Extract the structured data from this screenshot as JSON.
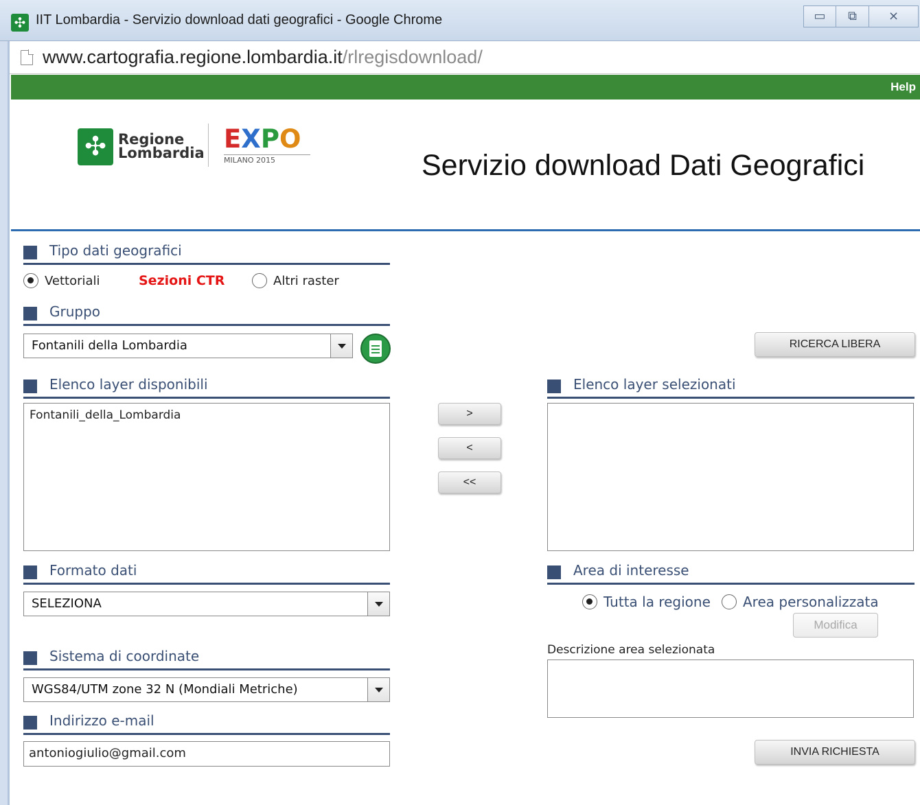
{
  "window": {
    "title": "IIT Lombardia - Servizio download dati geografici - Google Chrome",
    "controls": {
      "minimize": "▭",
      "maximize": "⧉",
      "close": "⨯"
    },
    "app_icon": "regione-lombardia-icon"
  },
  "address_bar": {
    "url_host": "www.cartografia.regione.lombardia.it",
    "url_path": "/rlregisdownload/"
  },
  "topbar": {
    "help_label": "Help",
    "color": "#3a8a38"
  },
  "header": {
    "logo_line1": "Regione",
    "logo_line2": "Lombardia",
    "expo_letters": [
      "E",
      "X",
      "P",
      "O"
    ],
    "expo_subtitle": "MILANO 2015",
    "title": "Servizio download Dati Geografici"
  },
  "tipo": {
    "section_label": "Tipo dati geografici",
    "options": [
      "Vettoriali",
      "Sezioni CTR",
      "Altri raster"
    ],
    "selected": "Vettoriali"
  },
  "gruppo": {
    "section_label": "Gruppo",
    "selected_value": "Fontanili della Lombardia"
  },
  "layer_disponibili": {
    "section_label": "Elenco layer disponibili",
    "items": [
      "Fontanili_della_Lombardia"
    ]
  },
  "transfer_buttons": {
    "add": ">",
    "remove": "<",
    "remove_all": "<<"
  },
  "layer_selezionati": {
    "section_label": "Elenco layer selezionati",
    "items": []
  },
  "ricerca_libera_label": "RICERCA LIBERA",
  "formato": {
    "section_label": "Formato dati",
    "selected_value": "SELEZIONA"
  },
  "area": {
    "section_label": "Area di interesse",
    "options": [
      "Tutta la regione",
      "Area personalizzata"
    ],
    "selected": "Tutta la regione",
    "modifica_label": "Modifica",
    "descrizione_label": "Descrizione area selezionata",
    "descrizione_value": ""
  },
  "coordinate": {
    "section_label": "Sistema di coordinate",
    "selected_value": "WGS84/UTM zone 32 N (Mondiali Metriche)"
  },
  "email": {
    "section_label": "Indirizzo e-mail",
    "value": "antoniogiulio@gmail.com"
  },
  "invia_label": "INVIA RICHIESTA",
  "colors": {
    "section_blue": "#3a4f74",
    "header_rule": "#2d6bb0",
    "sezioni_red": "#e51515"
  }
}
